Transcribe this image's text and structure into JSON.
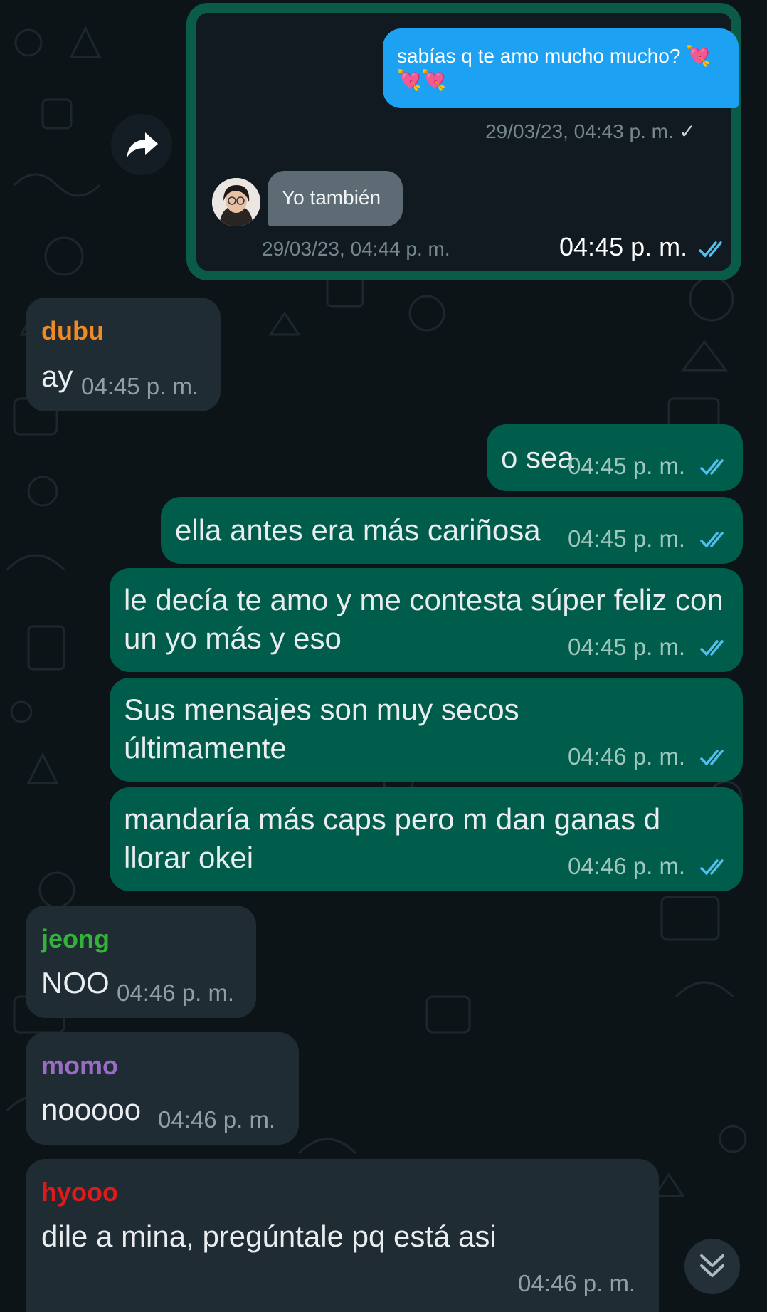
{
  "quoted_card": {
    "outgoing_text": "sabías q te amo mucho mucho? 💘💘💘",
    "outgoing_timestamp": "29/03/23, 04:43 p. m.",
    "outgoing_check": "✓",
    "incoming_text": "Yo también",
    "incoming_timestamp": "29/03/23, 04:44 p. m.",
    "send_time": "04:45 p. m."
  },
  "messages": [
    {
      "sender": "dubu",
      "text": "ay",
      "time": "04:45 p. m."
    },
    {
      "text": "o sea",
      "time": "04:45 p. m."
    },
    {
      "text": "ella antes era más cariñosa",
      "time": "04:45 p. m."
    },
    {
      "text": "le decía te amo y me contesta súper feliz con un yo más y eso",
      "time": "04:45 p. m."
    },
    {
      "text": "Sus mensajes son muy secos últimamente",
      "time": "04:46 p. m."
    },
    {
      "text": "mandaría más caps pero m dan ganas d llorar okei",
      "time": "04:46 p. m."
    },
    {
      "sender": "jeong",
      "text": "NOO",
      "time": "04:46 p. m."
    },
    {
      "sender": "momo",
      "text": "nooooo",
      "time": "04:46 p. m."
    },
    {
      "sender": "hyooo",
      "text": "dile a mina, pregúntale pq está asi",
      "time": "04:46 p. m."
    }
  ],
  "colors": {
    "background": "#0d1418",
    "incoming_bubble": "#1f2c34",
    "outgoing_bubble": "#005c4b",
    "read_ticks": "#53bdeb",
    "dubu": "#f08a24",
    "jeong": "#34b33a",
    "momo": "#9b6cc4",
    "hyooo": "#e0191b"
  },
  "icons": {
    "forward": "forward-arrow-icon",
    "read_receipt": "double-check-icon",
    "scroll_down": "chevron-double-down-icon"
  }
}
